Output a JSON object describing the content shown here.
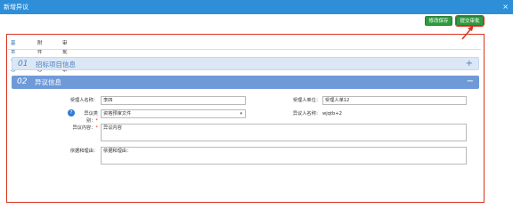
{
  "dialog": {
    "title": "新增异议",
    "close_glyph": "×"
  },
  "toolbar": {
    "save_label": "修改保存",
    "submit_label": "提交审批"
  },
  "tabs": [
    {
      "label": "基本信息"
    },
    {
      "label": "附件信息"
    },
    {
      "label": "审批记录"
    }
  ],
  "sections": [
    {
      "num": "01",
      "title": "招标项目信息",
      "toggle": "+"
    },
    {
      "num": "02",
      "title": "异议信息",
      "toggle": "−"
    }
  ],
  "form": {
    "recipient_name": {
      "label": "受理人名称：",
      "value": "李四"
    },
    "recipient_unit": {
      "label": "受理人单位：",
      "value": "受理人单12"
    },
    "objection_type": {
      "label": "异议类别：",
      "value": "资格预审文件",
      "required": "*"
    },
    "objector_name": {
      "label": "异议人名称：",
      "value": "wjqtb+2"
    },
    "objection_content": {
      "label": "异议内容：",
      "value": "异议内容",
      "required": "*"
    },
    "basis": {
      "label": "依据和理由：",
      "value": "依据和理由："
    }
  },
  "colors": {
    "titlebar": "#2e8fd8",
    "button_green": "#2f9a3f",
    "highlight_red": "#d9341f",
    "section_blue": "#6f9ad8"
  }
}
